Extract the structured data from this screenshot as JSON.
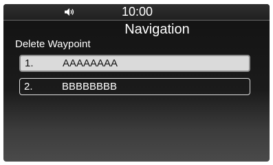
{
  "status_bar": {
    "clock": "10:00",
    "volume_icon": "speaker-icon"
  },
  "header": {
    "title": "Navigation"
  },
  "section": {
    "label": "Delete Waypoint"
  },
  "waypoints": [
    {
      "number": "1.",
      "name": "AAAAAAAA",
      "selected": true
    },
    {
      "number": "2.",
      "name": "BBBBBBBB",
      "selected": false
    }
  ],
  "colors": {
    "background": "#1b1b1b",
    "selected_row": "#dadada",
    "text": "#ffffff"
  }
}
